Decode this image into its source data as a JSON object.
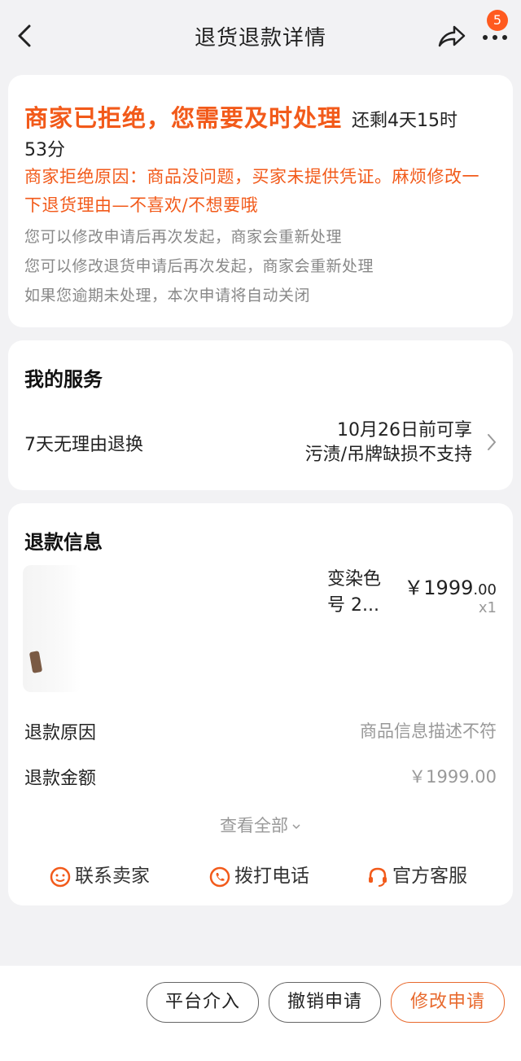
{
  "nav": {
    "title": "退货退款详情",
    "badge_count": "5",
    "share_icon": "share-icon",
    "more_icon": "more-icon"
  },
  "status": {
    "title": "商家已拒绝，您需要及时处理",
    "remaining_part1": "还剩4天15时",
    "remaining_part2": "53分",
    "reason": "商家拒绝原因：商品没问题，买家未提供凭证。麻烦修改一下退货理由—不喜欢/不想要哦",
    "hints": [
      "您可以修改申请后再次发起，商家会重新处理",
      "您可以修改退货申请后再次发起，商家会重新处理",
      "如果您逾期未处理，本次申请将自动关闭"
    ]
  },
  "service": {
    "title": "我的服务",
    "name": "7天无理由退换",
    "detail_line1": "10月26日前可享",
    "detail_line2": "污渍/吊牌缺损不支持"
  },
  "refund": {
    "title": "退款信息",
    "product": {
      "name": "变染色号 2...",
      "price_main": "￥1999",
      "price_cents": ".00",
      "qty": "x1"
    },
    "reason_label": "退款原因",
    "reason_value": "商品信息描述不符",
    "amount_label": "退款金额",
    "amount_value": "￥1999.00",
    "see_all": "查看全部",
    "contacts": [
      "联系卖家",
      "拨打电话",
      "官方客服"
    ]
  },
  "actions": {
    "platform": "平台介入",
    "cancel": "撤销申请",
    "modify": "修改申请"
  },
  "colors": {
    "accent": "#f25a1a",
    "badge": "#ff5a1f"
  }
}
